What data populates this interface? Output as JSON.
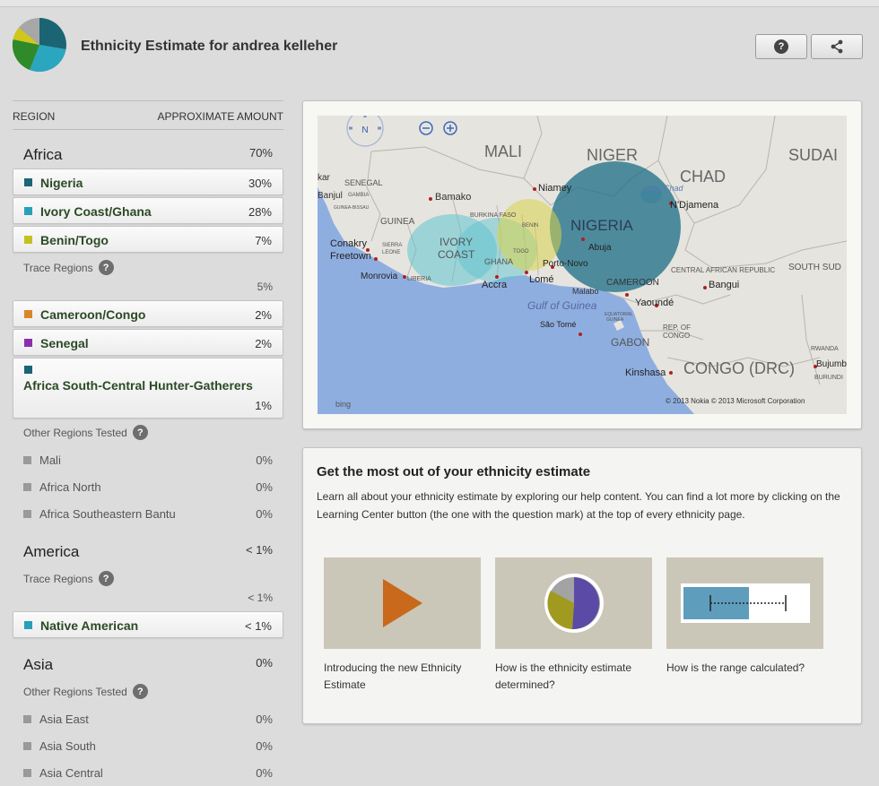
{
  "header": {
    "title": "Ethnicity Estimate for andrea kelleher",
    "help_icon": "question-icon",
    "share_icon": "share-icon",
    "logo_colors": [
      "#1a6473",
      "#2ba6bf",
      "#2f8a2a",
      "#d1c71a",
      "#a7a7a7"
    ]
  },
  "columns": {
    "region": "REGION",
    "amount": "APPROXIMATE AMOUNT"
  },
  "africa": {
    "label": "Africa",
    "value": "70%",
    "regions": [
      {
        "name": "Nigeria",
        "value": "30%",
        "color": "#1b6575"
      },
      {
        "name": "Ivory Coast/Ghana",
        "value": "28%",
        "color": "#28a0b7"
      },
      {
        "name": "Benin/Togo",
        "value": "7%",
        "color": "#c3c220"
      }
    ],
    "trace_label": "Trace Regions",
    "trace_value": "5%",
    "trace_regions": [
      {
        "name": "Cameroon/Congo",
        "value": "2%",
        "color": "#d9852a"
      },
      {
        "name": "Senegal",
        "value": "2%",
        "color": "#8b2fae"
      },
      {
        "name": "Africa South-Central Hunter-Gatherers",
        "value": "1%",
        "color": "#1b6575"
      }
    ],
    "other_label": "Other Regions Tested",
    "other_regions": [
      {
        "name": "Mali",
        "value": "0%"
      },
      {
        "name": "Africa North",
        "value": "0%"
      },
      {
        "name": "Africa Southeastern Bantu",
        "value": "0%"
      }
    ]
  },
  "america": {
    "label": "America",
    "value": "< 1%",
    "trace_label": "Trace Regions",
    "trace_value": "< 1%",
    "trace_regions": [
      {
        "name": "Native American",
        "value": "< 1%",
        "color": "#28a0b7"
      }
    ]
  },
  "asia": {
    "label": "Asia",
    "value": "0%",
    "other_label": "Other Regions Tested",
    "other_regions": [
      {
        "name": "Asia East",
        "value": "0%"
      },
      {
        "name": "Asia South",
        "value": "0%"
      },
      {
        "name": "Asia Central",
        "value": "0%"
      }
    ]
  },
  "map": {
    "compass": "N",
    "labels": {
      "mali": "MALI",
      "niger": "NIGER",
      "chad": "CHAD",
      "sudan": "SUDAI",
      "senegal": "SENEGAL",
      "dakar": "kar",
      "banjul": "Banjul",
      "gambia": "GAMBIA",
      "guinea_bissau": "GUINEA-BISSAU",
      "guinea": "GUINEA",
      "bamako": "Bamako",
      "burkina": "BURKINA FASO",
      "niamey": "Niamey",
      "lake_chad": "Lake Chad",
      "ndjamena": "N'Djamena",
      "nigeria": "NIGERIA",
      "abuja": "Abuja",
      "ivory1": "IVORY",
      "ivory2": "COAST",
      "ghana": "GHANA",
      "togo": "TOGO",
      "benin": "BENIN",
      "conakry": "Conakry",
      "freetown": "Freetown",
      "sierra1": "SIERRA",
      "sierra2": "LEONE",
      "monrovia": "Monrovia",
      "liberia": "LIBERIA",
      "accra": "Accra",
      "lome": "Lomé",
      "porto_novo": "Porto-Novo",
      "car": "CENTRAL AFRICAN REPUBLIC",
      "south_sudan": "SOUTH SUD",
      "bangui": "Bangui",
      "cameroon": "CAMEROON",
      "malabo": "Malabo",
      "yaounde": "Yaoundé",
      "gulf": "Gulf of Guinea",
      "eq1": "EQUATORIAL",
      "eq2": "GUINEA",
      "sao_tome": "São Tomé",
      "gabon": "GABON",
      "rep1": "REP. OF",
      "rep2": "CONGO",
      "congo_drc": "CONGO (DRC)",
      "kinshasa": "Kinshasa",
      "rwanda": "RWANDA",
      "bujumbura": "Bujumb",
      "burundi": "BURUNDI"
    },
    "attribution": "© 2013 Nokia    © 2013 Microsoft Corporation",
    "bing": "bing"
  },
  "info": {
    "title": "Get the most out of your ethnicity estimate",
    "description": "Learn all about your ethnicity estimate by exploring our help content. You can find a lot more by clicking on the Learning Center button (the one with the question mark) at the top of every ethnicity page.",
    "tiles": [
      {
        "caption": "Introducing the new Ethnicity Estimate",
        "icon": "play-icon"
      },
      {
        "caption": "How is the ethnicity estimate determined?",
        "icon": "pie-chart-icon"
      },
      {
        "caption": "How is the range calculated?",
        "icon": "range-bar-icon"
      }
    ]
  }
}
